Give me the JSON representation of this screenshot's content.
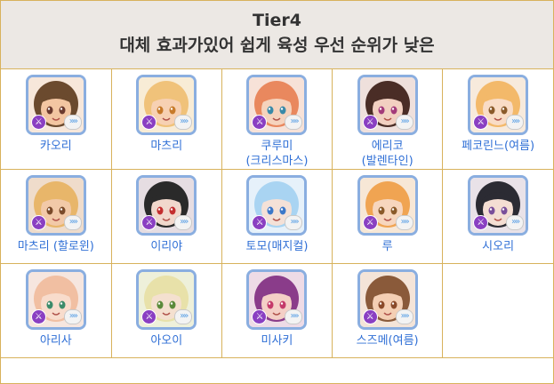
{
  "header": {
    "title": "Tier4",
    "subtitle": "대체 효과가있어 쉽게 육성 우선 순위가 낮은"
  },
  "badges": {
    "left_icon": "sword-icon",
    "right_icon": "chevron-icon",
    "left_glyph": "⚔",
    "right_glyph": "»»"
  },
  "characters": [
    {
      "name": "카오리",
      "hair": "#6b4a2e",
      "skin": "#f3c6a2",
      "eye": "#6b3a2e",
      "bg": "#f7e7da"
    },
    {
      "name": "마츠리",
      "hair": "#f0c27a",
      "skin": "#f7d1b3",
      "eye": "#c77a2a",
      "bg": "#f8ecd6"
    },
    {
      "name": "쿠루미\n(크리스마스)",
      "hair": "#e9885e",
      "skin": "#f6d3bd",
      "eye": "#3a8aa8",
      "bg": "#f7e2d8"
    },
    {
      "name": "에리코\n(발렌타인)",
      "hair": "#4a2d26",
      "skin": "#f2d0c1",
      "eye": "#a33a7a",
      "bg": "#efe0dc"
    },
    {
      "name": "페코린느(여름)",
      "hair": "#f3b96a",
      "skin": "#f9dcc6",
      "eye": "#8a5a2a",
      "bg": "#f7eadc"
    },
    {
      "name": "마츠리 (할로윈)",
      "hair": "#e8b66a",
      "skin": "#f2c9a8",
      "eye": "#7a4a2a",
      "bg": "#efdccb"
    },
    {
      "name": "이리야",
      "hair": "#2a2a2a",
      "skin": "#f1d8cc",
      "eye": "#c32e2e",
      "bg": "#e6dde2"
    },
    {
      "name": "토모(매지컬)",
      "hair": "#a9d4f2",
      "skin": "#f4e1d7",
      "eye": "#3b78c9",
      "bg": "#e6f1fa"
    },
    {
      "name": "루",
      "hair": "#f0a452",
      "skin": "#f7d6be",
      "eye": "#8a5a2a",
      "bg": "#f7e7d6"
    },
    {
      "name": "시오리",
      "hair": "#2b2b33",
      "skin": "#f4ded3",
      "eye": "#7a4f9a",
      "bg": "#e9e2e8"
    },
    {
      "name": "아리사",
      "hair": "#f1bfa2",
      "skin": "#f8dccc",
      "eye": "#3b8b6a",
      "bg": "#f6e6df"
    },
    {
      "name": "아오이",
      "hair": "#e8e1a9",
      "skin": "#f4e0cf",
      "eye": "#5a8a3a",
      "bg": "#eef0da"
    },
    {
      "name": "미사키",
      "hair": "#8a3c8a",
      "skin": "#f4cfc6",
      "eye": "#c53a6a",
      "bg": "#eedbe6"
    },
    {
      "name": "스즈메(여름)",
      "hair": "#8a5a3a",
      "skin": "#f4cfb4",
      "eye": "#8a4a2a",
      "bg": "#f4e4d8"
    },
    {
      "name": "",
      "hair": "",
      "skin": "",
      "eye": "",
      "bg": ""
    }
  ]
}
